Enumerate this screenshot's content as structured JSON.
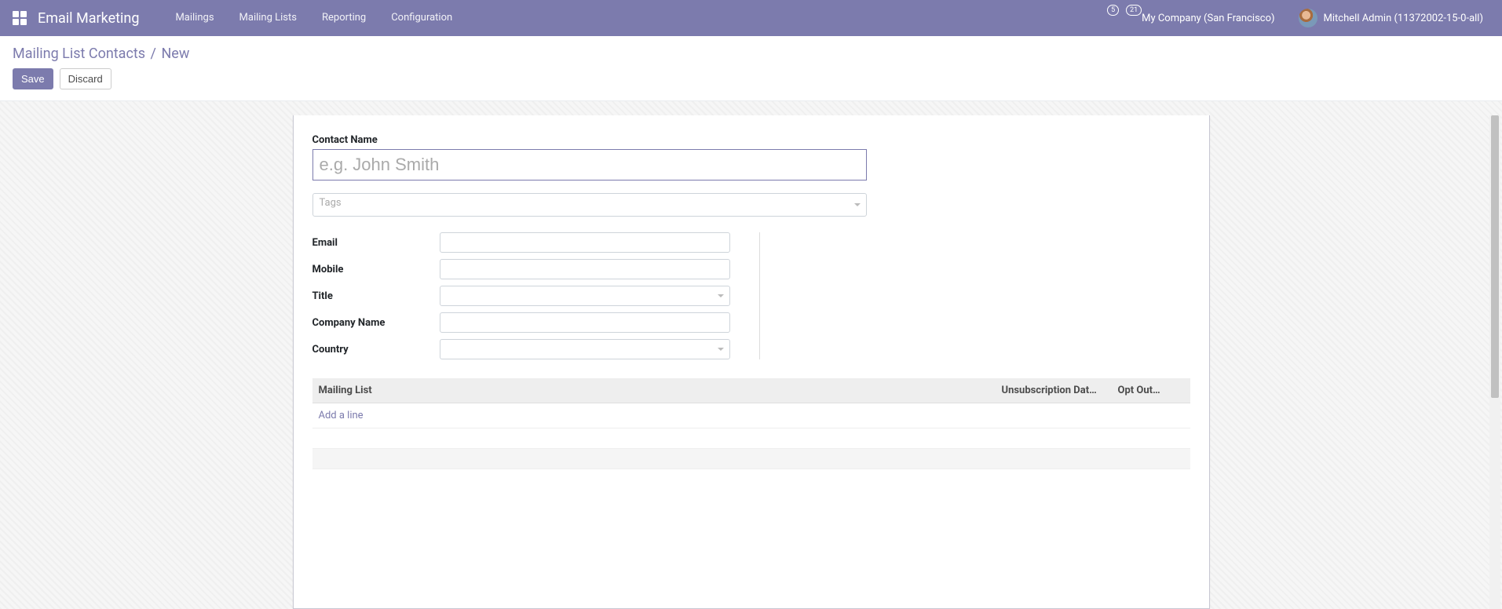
{
  "topbar": {
    "app_title": "Email Marketing",
    "menu": [
      "Mailings",
      "Mailing Lists",
      "Reporting",
      "Configuration"
    ],
    "chat_badge": "5",
    "activity_badge": "21",
    "company": "My Company (San Francisco)",
    "user": "Mitchell Admin (11372002-15-0-all)"
  },
  "breadcrumb": {
    "parent": "Mailing List Contacts",
    "current": "New"
  },
  "buttons": {
    "save": "Save",
    "discard": "Discard"
  },
  "form": {
    "contact_name_label": "Contact Name",
    "contact_name_placeholder": "e.g. John Smith",
    "contact_name_value": "",
    "tags_placeholder": "Tags",
    "email_label": "Email",
    "email_value": "",
    "mobile_label": "Mobile",
    "mobile_value": "",
    "title_label": "Title",
    "title_value": "",
    "company_name_label": "Company Name",
    "company_name_value": "",
    "country_label": "Country",
    "country_value": ""
  },
  "list": {
    "col_mailing_list": "Mailing List",
    "col_unsub": "Unsubscription Dat…",
    "col_optout": "Opt Out…",
    "add_line": "Add a line"
  }
}
